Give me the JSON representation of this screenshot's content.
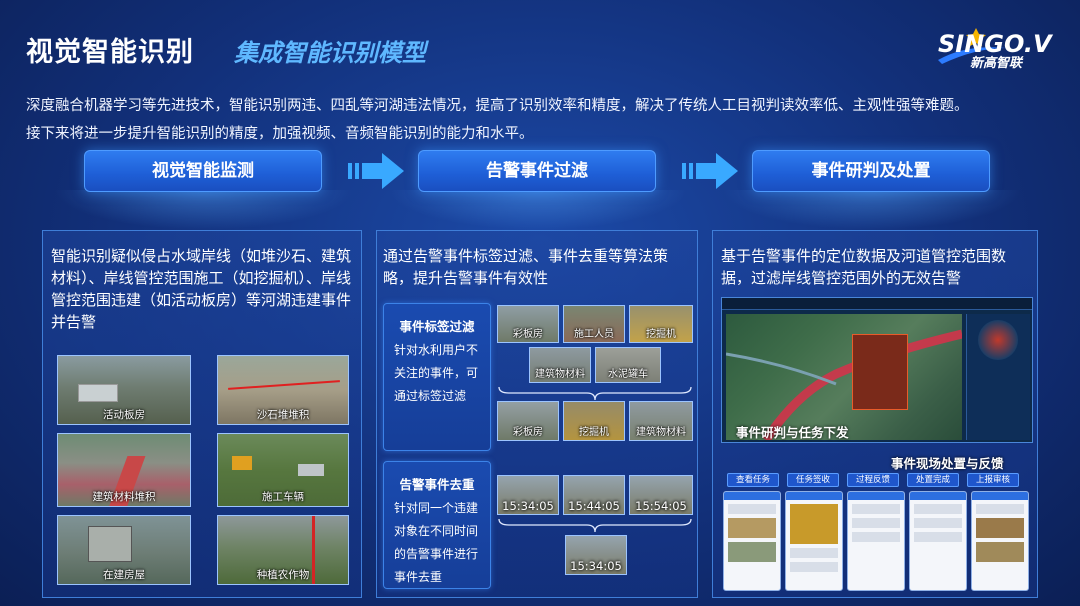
{
  "header": {
    "title": "视觉智能识别",
    "subtitle": "集成智能识别模型",
    "logo_text": "SINGO.V",
    "logo_cn": "新高智联"
  },
  "intro": {
    "line1": "深度融合机器学习等先进技术，智能识别两违、四乱等河湖违法情况，提高了识别效率和精度，解决了传统人工目视判读效率低、主观性强等难题。",
    "line2": "接下来将进一步提升智能识别的精度，加强视频、音频智能识别的能力和水平。"
  },
  "stages": [
    {
      "label": "视觉智能监测"
    },
    {
      "label": "告警事件过滤"
    },
    {
      "label": "事件研判及处置"
    }
  ],
  "panel1": {
    "text": "智能识别疑似侵占水域岸线（如堆沙石、建筑材料）、岸线管控范围施工（如挖掘机）、岸线管控范围违建（如活动板房）等河湖违建事件并告警",
    "thumbs": [
      {
        "label": "活动板房"
      },
      {
        "label": "沙石堆堆积"
      },
      {
        "label": "建筑材料堆积"
      },
      {
        "label": "施工车辆"
      },
      {
        "label": "在建房屋"
      },
      {
        "label": "种植农作物"
      }
    ]
  },
  "panel2": {
    "text": "通过告警事件标签过滤、事件去重等算法策略，提升告警事件有效性",
    "tag_filter": {
      "title": "事件标签过滤",
      "body": "针对水利用户不关注的事件，可通过标签过滤"
    },
    "tag_thumbs_top": [
      "彩板房",
      "施工人员",
      "挖掘机",
      "建筑物材料",
      "水泥罐车"
    ],
    "tag_thumbs_bottom": [
      "彩板房",
      "挖掘机",
      "建筑物材料"
    ],
    "dedup": {
      "title": "告警事件去重",
      "body": "针对同一个违建对象在不同时间的告警事件进行事件去重"
    },
    "times_top": [
      "15:34:05",
      "15:44:05",
      "15:54:05"
    ],
    "time_bottom": "15:34:05"
  },
  "panel3": {
    "text": "基于告警事件的定位数据及河道管控范围数据，过滤岸线管控范围外的无效告警",
    "screen_caption": "事件研判与任务下发",
    "flow_title": "事件现场处置与反馈",
    "flow_steps": [
      "查看任务",
      "任务签收",
      "过程反馈",
      "处置完成",
      "上报审核"
    ]
  },
  "colors": {
    "accent": "#5fb8ff",
    "stage": "#2f7cf0",
    "panel_border": "#3f7ed8"
  }
}
